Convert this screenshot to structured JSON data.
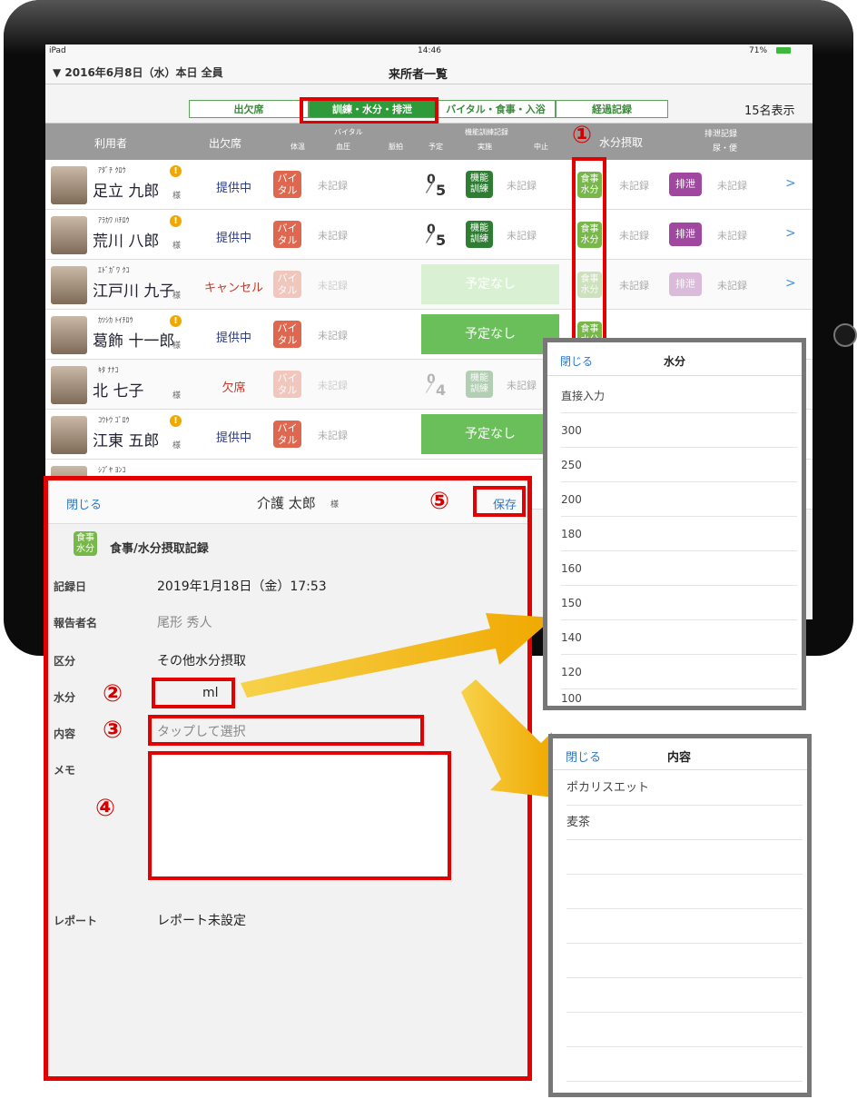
{
  "status": {
    "device": "iPad",
    "time": "14:46",
    "battery": "71%"
  },
  "nav": {
    "date": "▼ 2016年6月8日（水）本日 全員",
    "title": "来所者一覧"
  },
  "tabs": [
    {
      "label": "出欠席"
    },
    {
      "label": "訓練・水分・排泄"
    },
    {
      "label": "バイタル・食事・入浴"
    },
    {
      "label": "経過記録"
    }
  ],
  "count_label": "15名表示",
  "headers": {
    "user": "利用者",
    "attendance": "出欠席",
    "vital": "バイタル",
    "vital_sub": [
      "体温",
      "血圧",
      "脈拍"
    ],
    "training": "機能訓練記録",
    "training_sub": [
      "予定",
      "実施",
      "中止"
    ],
    "water": "水分摂取",
    "excretion": "排泄記録",
    "excretion_sub": "尿・便"
  },
  "common": {
    "unrecorded": "未記録",
    "sama": "様",
    "vital_icon": "バイ\nタル",
    "kinou_icon": "機能\n訓練",
    "meal_icon": "食事\n水分",
    "excr_icon": "排泄",
    "no_plan": "予定なし",
    "chevron": ">"
  },
  "rows": [
    {
      "kana": "ｱﾀﾞﾁ ｸﾛｳ",
      "name": "足立 九郎",
      "attendance": "提供中",
      "plan": "0",
      "total": "5"
    },
    {
      "kana": "ｱﾗｶﾜ ﾊﾁﾛｳ",
      "name": "荒川 八郎",
      "attendance": "提供中",
      "plan": "0",
      "total": "5"
    },
    {
      "kana": "ｴﾄﾞｶﾞﾜ ｸｺ",
      "name": "江戸川 九子",
      "attendance": "キャンセル",
      "plan": "",
      "total": ""
    },
    {
      "kana": "ｶﾂｼｶ ﾄｲﾁﾛｳ",
      "name": "葛飾 十一郎",
      "attendance": "提供中",
      "plan": "",
      "total": ""
    },
    {
      "kana": "ｷﾀ ﾅﾅｺ",
      "name": "北 七子",
      "attendance": "欠席",
      "plan": "0",
      "total": "4"
    },
    {
      "kana": "ｺｳﾄｳ ｺﾞﾛｳ",
      "name": "江東 五郎",
      "attendance": "提供中",
      "plan": "",
      "total": ""
    },
    {
      "kana": "ｼﾌﾞﾔ ﾖﾝｺ",
      "name": "",
      "attendance": "",
      "plan": "",
      "total": ""
    }
  ],
  "modal": {
    "close": "閉じる",
    "title": "介護 太郎",
    "sama": "様",
    "save": "保存",
    "icon": "食事\n水分",
    "subtitle": "食事/水分摂取記録",
    "fields": [
      {
        "label": "記録日",
        "value": "2019年1月18日（金）17:53"
      },
      {
        "label": "報告者名",
        "value": "尾形 秀人"
      },
      {
        "label": "区分",
        "value": "その他水分摂取"
      },
      {
        "label": "水分",
        "value": "ml"
      },
      {
        "label": "内容",
        "value": "タップして選択"
      },
      {
        "label": "メモ",
        "value": ""
      },
      {
        "label": "レポート",
        "value": "レポート未設定"
      }
    ]
  },
  "water_popup": {
    "close": "閉じる",
    "title": "水分",
    "options": [
      "直接入力",
      "300",
      "250",
      "200",
      "180",
      "160",
      "150",
      "140",
      "120",
      "100"
    ]
  },
  "content_popup": {
    "close": "閉じる",
    "title": "内容",
    "options": [
      "ポカリスエット",
      "麦茶"
    ]
  },
  "callouts": [
    "①",
    "②",
    "③",
    "④",
    "⑤"
  ],
  "colors": {
    "highlight": "#e30000",
    "arrow": "#f0b400",
    "green": "#6abf5a",
    "vital": "#e0674f",
    "excretion": "#a0489f"
  }
}
